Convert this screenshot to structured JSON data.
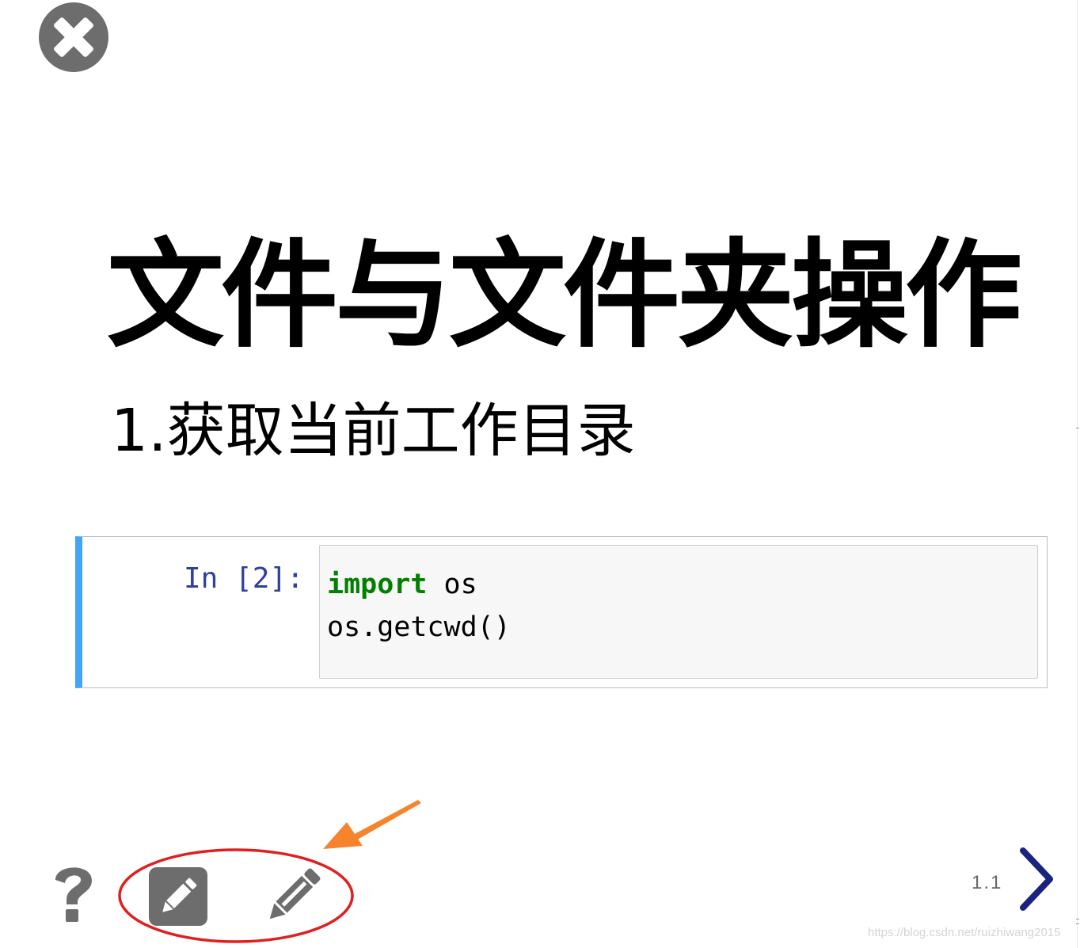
{
  "slide": {
    "title": "文件与文件夹操作",
    "subtitle": "1.获取当前工作目录"
  },
  "code_cell": {
    "prompt": "In [2]:",
    "lines": [
      {
        "keyword": "import",
        "rest": " os"
      },
      {
        "keyword": "",
        "rest": "os.getcwd()"
      }
    ]
  },
  "controls": {
    "close_icon": "close-icon",
    "help_icon": "help-icon",
    "edit_square_icon": "edit-square-icon",
    "pencil_icon": "pencil-icon",
    "next_icon": "chevron-right-icon"
  },
  "navigation": {
    "slide_number": "1.1"
  },
  "watermark": "https://blog.csdn.net/ruizhiwang2015",
  "colors": {
    "cell_border_accent": "#42a5f5",
    "prompt": "#303f9f",
    "keyword": "#008000",
    "icon_gray": "#6d6d6d",
    "next_arrow": "#1a237e",
    "annotation_red": "#e02020",
    "annotation_orange": "#f5842c"
  }
}
